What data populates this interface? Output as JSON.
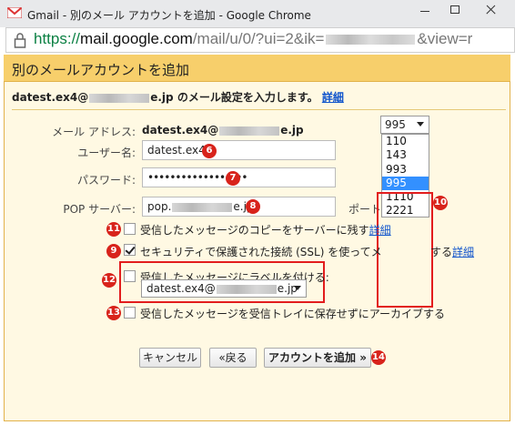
{
  "browser": {
    "window_title": "Gmail - 別のメール アカウントを追加 - Google Chrome",
    "url_scheme": "https://",
    "url_host": "mail.google.com",
    "url_path_start": "/mail/u/0/?ui=2&ik=",
    "url_path_end": "&view=r"
  },
  "dialog": {
    "heading": "別のメールアカウントを追加",
    "intro_prefix": "datest.ex4@",
    "intro_suffix": "e.jp のメール設定を入力します。",
    "intro_link": "詳細"
  },
  "form": {
    "email_label": "メール アドレス:",
    "email_prefix": "datest.ex4@",
    "email_suffix": "e.jp",
    "username_label": "ユーザー名:",
    "username_value": "datest.ex4",
    "password_label": "パスワード:",
    "password_value": "••••••••••••••••••",
    "pop_label": "POP サーバー:",
    "pop_prefix": "pop.",
    "pop_suffix": "e.jp",
    "port_label": "ポート:",
    "port_value": "995",
    "port_options": [
      "110",
      "143",
      "993",
      "995",
      "1110",
      "2221"
    ],
    "port_selected": "995",
    "opt_leave_copy": "受信したメッセージのコピーをサーバーに残す",
    "opt_leave_copy_link": "詳細",
    "opt_ssl": "セキュリティで保護された接続 (SSL) を使ってメ",
    "opt_ssl_tail": "する",
    "opt_ssl_link": "詳細",
    "opt_ssl_checked": true,
    "opt_label": "受信したメッセージにラベルを付ける:",
    "label_select_prefix": "datest.ex4@",
    "label_select_suffix": "e.jp",
    "opt_archive": "受信したメッセージを受信トレイに保存せずにアーカイブする"
  },
  "buttons": {
    "cancel": "キャンセル",
    "back": "«戻る",
    "add": "アカウントを追加 »"
  },
  "badges": {
    "username": "6",
    "password": "7",
    "pop": "8",
    "ssl": "9",
    "port": "10",
    "leave_copy": "11",
    "label": "12",
    "archive": "13",
    "add": "14"
  },
  "colors": {
    "header": "#f7cf6b",
    "body": "#fff9e3",
    "badge": "#d8231b",
    "highlight_box": "#e21d1d",
    "selected_option": "#3390ff"
  }
}
